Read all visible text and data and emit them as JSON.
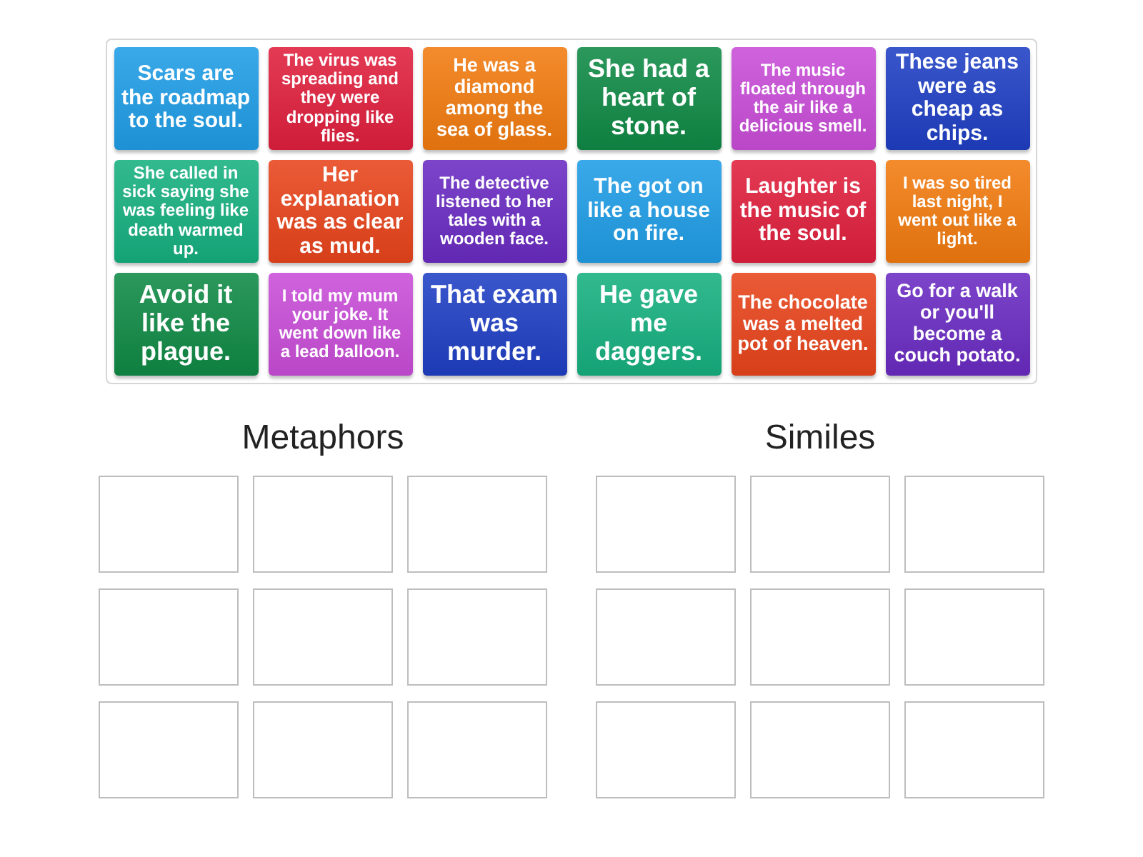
{
  "cards": [
    {
      "text": "Scars are the roadmap to the soul.",
      "color": "#1f9de6"
    },
    {
      "text": "The virus was spreading and they were dropping like flies.",
      "color": "#e01f3d"
    },
    {
      "text": "He was a diamond among the sea of glass.",
      "color": "#f27b0f"
    },
    {
      "text": "She had a heart of stone.",
      "color": "#0f8a45"
    },
    {
      "text": "The music floated through the air like a delicious smell.",
      "color": "#c94dd8"
    },
    {
      "text": "These jeans were as cheap as chips.",
      "color": "#1f3fc4"
    },
    {
      "text": "She called in sick saying she was feeling like death warmed up.",
      "color": "#16b07f"
    },
    {
      "text": "Her explanation was as clear as mud.",
      "color": "#e8441b"
    },
    {
      "text": "The detective listened to her tales with a wooden face.",
      "color": "#6a2bc2"
    },
    {
      "text": "The got on like a house on fire.",
      "color": "#1f9de6"
    },
    {
      "text": "Laughter is the music of the soul.",
      "color": "#e01f3d"
    },
    {
      "text": "I was so tired last night, I went out like a light.",
      "color": "#f27b0f"
    },
    {
      "text": "Avoid it like the plague.",
      "color": "#0f8a45"
    },
    {
      "text": "I told my mum your joke. It went down like a lead balloon.",
      "color": "#c94dd8"
    },
    {
      "text": "That exam was murder.",
      "color": "#1f3fc4"
    },
    {
      "text": "He gave me daggers.",
      "color": "#16b07f"
    },
    {
      "text": "The chocolate was a melted pot of heaven.",
      "color": "#e8441b"
    },
    {
      "text": "Go for a walk or you'll become a couch potato.",
      "color": "#6a2bc2"
    }
  ],
  "groups": [
    {
      "title": "Metaphors"
    },
    {
      "title": "Similes"
    }
  ]
}
